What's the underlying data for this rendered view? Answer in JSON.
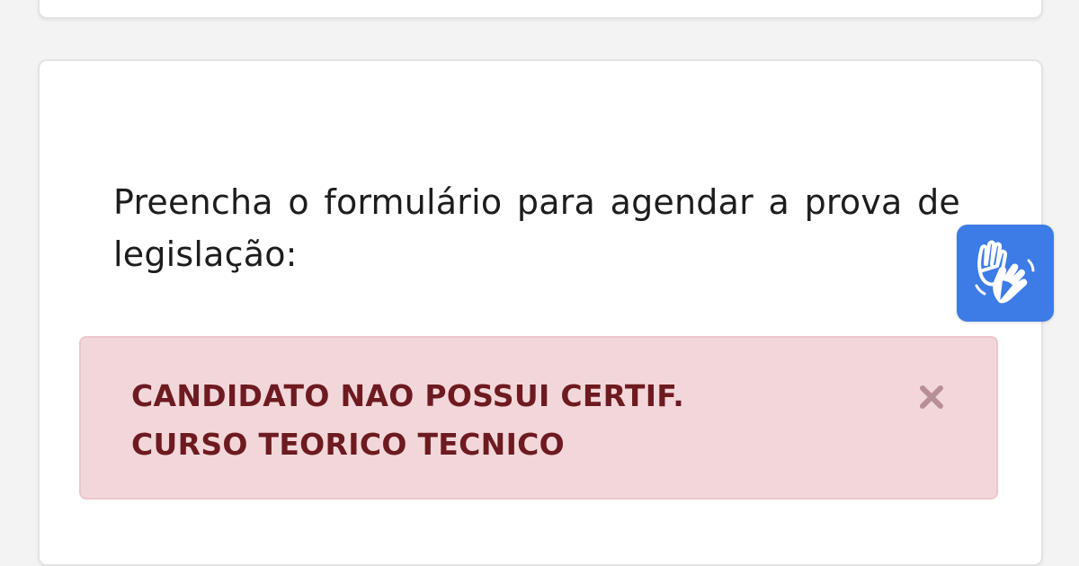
{
  "form": {
    "instruction": "Preencha o formulário para agendar a prova de legislação:"
  },
  "alert": {
    "message": "CANDIDATO NAO POSSUI CERTIF.\nCURSO TEORICO TECNICO",
    "close_icon": "close-icon",
    "background_color": "#f2d7da",
    "text_color": "#6d1a20"
  },
  "accessibility": {
    "icon": "sign-language-hands-icon",
    "background_color": "#3d7be6"
  }
}
